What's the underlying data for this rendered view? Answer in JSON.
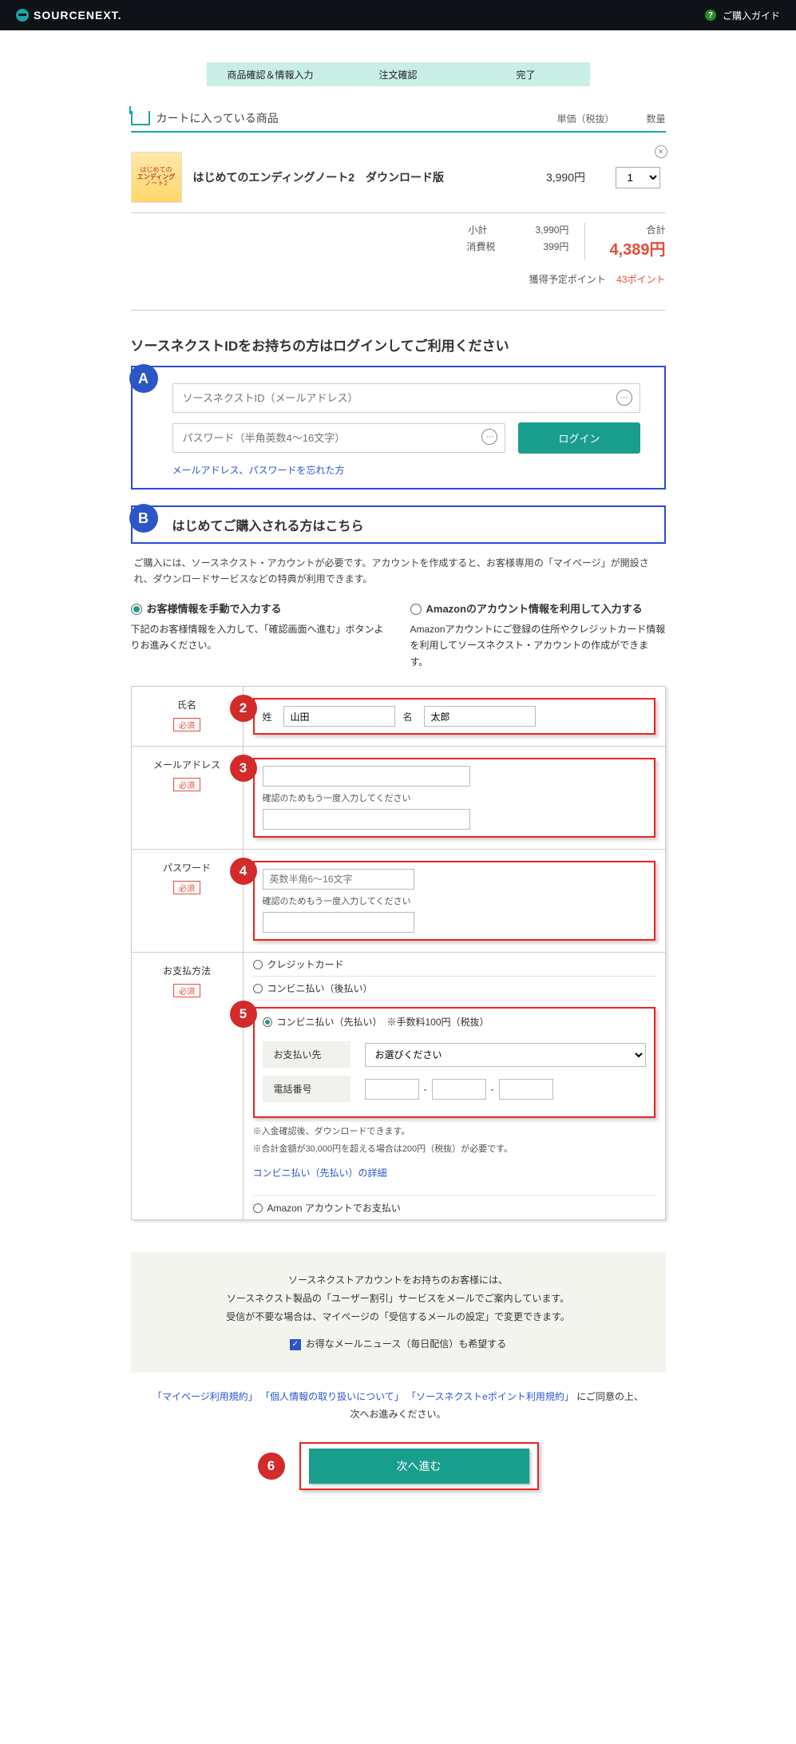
{
  "header": {
    "logo_text": "SOURCENEXT.",
    "guide_label": "ご購入ガイド",
    "help_glyph": "?"
  },
  "steps": {
    "s1": "商品確認＆情報入力",
    "s2": "注文確認",
    "s3": "完了"
  },
  "cart": {
    "title": "カートに入っている商品",
    "col_price": "単価（税抜）",
    "col_qty": "数量",
    "thumb_line1": "はじめての",
    "thumb_line2": "エンディング",
    "thumb_line3": "ノート2",
    "item_name": "はじめてのエンディングノート2　ダウンロード版",
    "item_price": "3,990円",
    "item_qty_value": "1",
    "close_glyph": "×",
    "sub_label": "小計",
    "sub_value": "3,990円",
    "tax_label": "消費税",
    "tax_value": "399円",
    "total_label": "合計",
    "total_value": "4,389円",
    "points_label": "獲得予定ポイント",
    "points_value": "43ポイント"
  },
  "login": {
    "sec_title": "ソースネクストIDをお持ちの方はログインしてご利用ください",
    "badge": "A",
    "id_placeholder": "ソースネクストID（メールアドレス）",
    "pw_placeholder": "パスワード（半角英数4～16文字）",
    "btn": "ログイン",
    "forgot": "メールアドレス、パスワードを忘れた方",
    "key_glyph": "⋯"
  },
  "first": {
    "badge": "B",
    "title": "はじめてご購入される方はこちら",
    "desc": "ご購入には、ソースネクスト・アカウントが必要です。アカウントを作成すると、お客様専用の「マイページ」が開設され、ダウンロードサービスなどの特典が利用できます。",
    "opt_manual_title": "お客様情報を手動で入力する",
    "opt_manual_desc": "下記のお客様情報を入力して、「確認画面へ進む」ボタンよりお進みください。",
    "opt_amazon_title": "Amazonのアカウント情報を利用して入力する",
    "opt_amazon_desc": "Amazonアカウントにご登録の住所やクレジットカード情報を利用してソースネクスト・アカウントの作成ができます。"
  },
  "form": {
    "name_label": "氏名",
    "required": "必須",
    "sei_label": "姓",
    "sei_value": "山田",
    "mei_label": "名",
    "mei_value": "太郎",
    "email_label": "メールアドレス",
    "email_confirm_note": "確認のためもう一度入力してください",
    "pw_label": "パスワード",
    "pw_placeholder": "英数半角6～16文字",
    "pw_confirm_note": "確認のためもう一度入力してください",
    "pay_label": "お支払方法",
    "pay_credit": "クレジットカード",
    "pay_conv_post": "コンビニ払い（後払い）",
    "pay_conv_pre": "コンビニ払い（先払い）　※手数料100円（税抜）",
    "pay_dest_label": "お支払い先",
    "pay_dest_placeholder": "お選びください",
    "phone_label": "電話番号",
    "phone_sep": "-",
    "pay_note1": "※入金確認後、ダウンロードできます。",
    "pay_note2": "※合計金額が30,000円を超える場合は200円（税抜）が必要です。",
    "pay_detail_link": "コンビニ払い（先払い）の詳細",
    "pay_amazon": "Amazon アカウントでお支払い",
    "badge2": "2",
    "badge3": "3",
    "badge4": "4",
    "badge5": "5"
  },
  "info_box": {
    "line1": "ソースネクストアカウントをお持ちのお客様には、",
    "line2": "ソースネクスト製品の「ユーザー割引」サービスをメールでご案内しています。",
    "line3": "受信が不要な場合は、マイページの「受信するメールの設定」で変更できます。",
    "cb_glyph": "✓",
    "cb_label": "お得なメールニュース（毎日配信）も希望する"
  },
  "agree": {
    "link1": "「マイページ利用規約」",
    "link2": "「個人情報の取り扱いについて」",
    "link3": "「ソースネクストeポイント利用規約」",
    "tail": "にご同意の上、",
    "line2": "次へお進みください。"
  },
  "next": {
    "badge": "6",
    "btn": "次へ進む"
  }
}
